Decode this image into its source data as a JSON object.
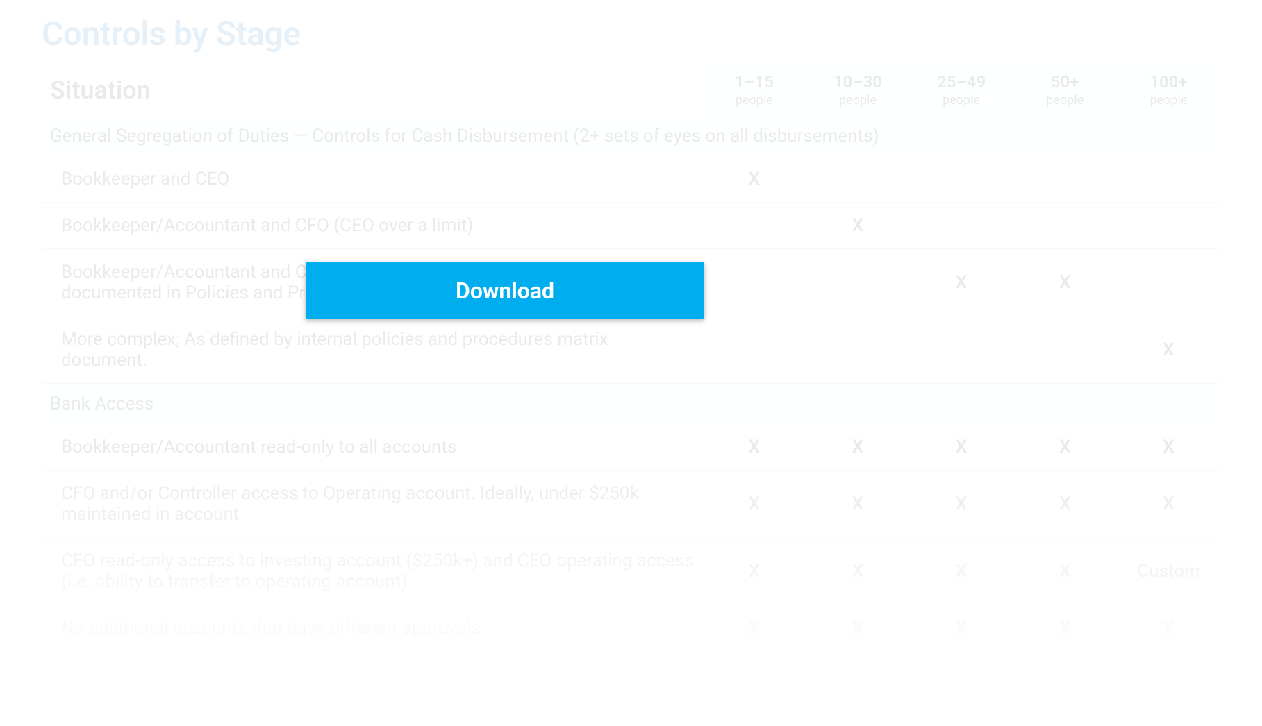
{
  "title": "Controls by Stage",
  "download_label": "Download",
  "table": {
    "situation_header": "Situation",
    "people_label": "people",
    "columns": [
      {
        "range": "1–15"
      },
      {
        "range": "10–30"
      },
      {
        "range": "25–49"
      },
      {
        "range": "50+"
      },
      {
        "range": "100+"
      }
    ],
    "sections": [
      {
        "label": "General Segregation of Duties — Controls for Cash Disbursement (2+ sets of eyes on all disbursements)",
        "rows": [
          {
            "label": "Bookkeeper and CEO",
            "marks": [
              "X",
              "",
              "",
              "",
              ""
            ]
          },
          {
            "label": "Bookkeeper/Accountant and CFO (CEO over a limit)",
            "marks": [
              "",
              "X",
              "",
              "",
              ""
            ]
          },
          {
            "label": "Bookkeeper/Accountant and CFO or Controller (CEO over a limit) — or as documented in Policies and Procedures",
            "marks": [
              "",
              "",
              "X",
              "X",
              ""
            ]
          },
          {
            "label": "More complex; As defined by internal policies and procedures matrix document.",
            "marks": [
              "",
              "",
              "",
              "",
              "X"
            ]
          }
        ]
      },
      {
        "label": "Bank Access",
        "rows": [
          {
            "label": "Bookkeeper/Accountant read-only to all accounts",
            "marks": [
              "X",
              "X",
              "X",
              "X",
              "X"
            ]
          },
          {
            "label": "CFO and/or Controller access to Operating account. Ideally, under $250k maintained in account",
            "marks": [
              "X",
              "X",
              "X",
              "X",
              "X"
            ]
          },
          {
            "label": "CFO read-only access to investing account ($250k+) and CEO operating access (i.e. ability to transfer to operating account)",
            "marks": [
              "X",
              "X",
              "X",
              "X",
              "Custom"
            ]
          },
          {
            "label": "No additional accounts that have different approvals",
            "marks": [
              "X",
              "X",
              "X",
              "X",
              "X"
            ]
          }
        ]
      }
    ]
  }
}
